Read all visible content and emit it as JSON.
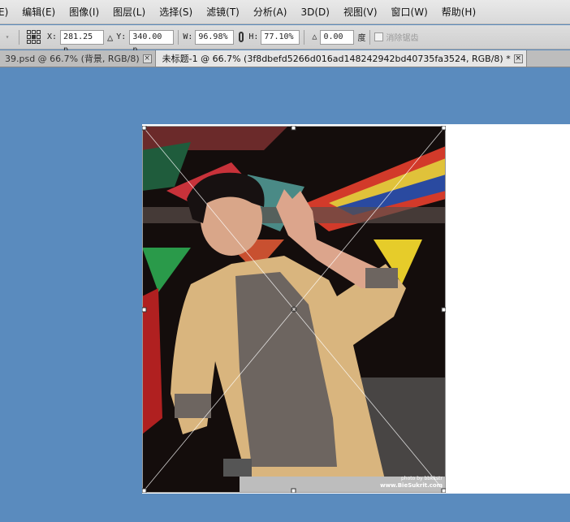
{
  "menu": [
    "E)",
    "编辑(E)",
    "图像(I)",
    "图层(L)",
    "选择(S)",
    "滤镜(T)",
    "分析(A)",
    "3D(D)",
    "视图(V)",
    "窗口(W)",
    "帮助(H)"
  ],
  "options": {
    "x_label": "X:",
    "x_value": "281.25 p",
    "delta": "△",
    "y_label": "Y:",
    "y_value": "340.00 p",
    "w_label": "W:",
    "w_value": "96.98%",
    "h_label": "H:",
    "h_value": "77.10%",
    "angle_icon": "△",
    "angle_value": "0.00",
    "angle_unit": "度",
    "antialias_label": "消除锯齿"
  },
  "tabs": [
    {
      "label": "39.psd @ 66.7% (背景, RGB/8)",
      "active": false
    },
    {
      "label": "未标题-1 @ 66.7% (3f8dbefd5266d016ad148242942bd40735fa3524, RGB/8) *",
      "active": true
    }
  ],
  "photo": {
    "watermark_line1": "photo by bbkkstr",
    "watermark_line2": "www.BieSukrit.com"
  },
  "colors": {
    "workspace": "#5a8bbe",
    "jacket": "#d9b57e"
  }
}
